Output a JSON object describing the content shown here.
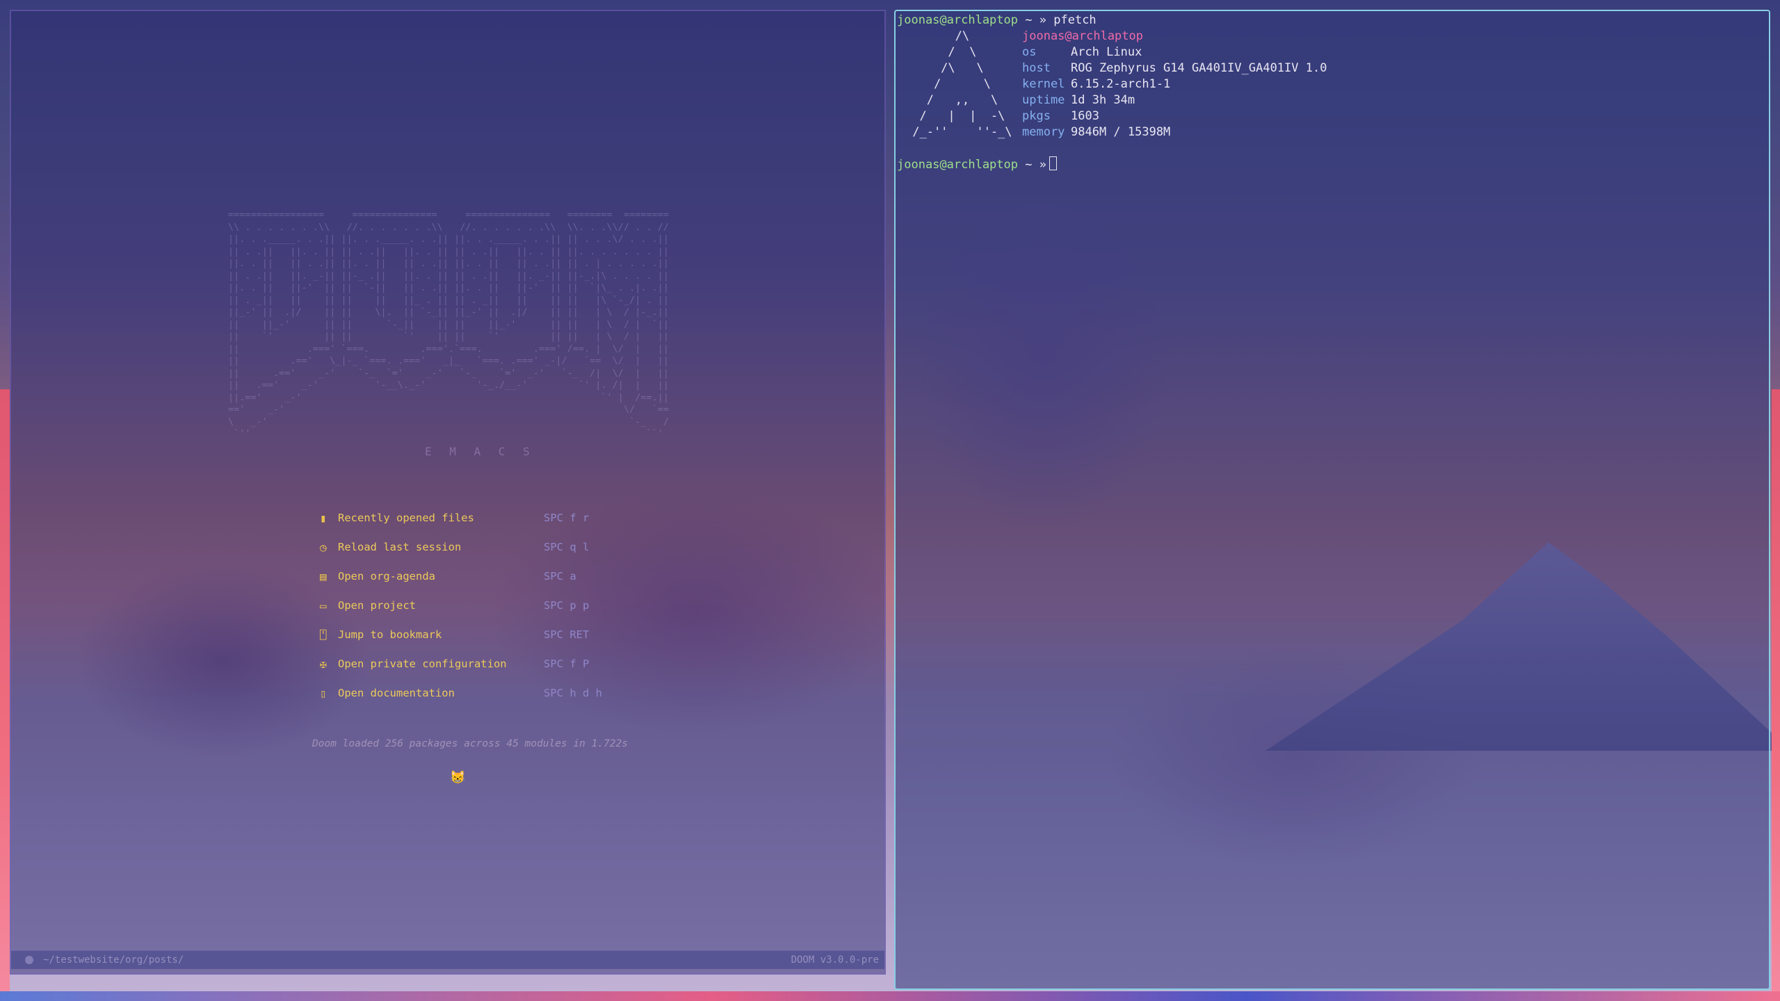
{
  "emacs": {
    "banner_ascii": "=================     ===============     ===============   ========  ========\n\\\\ . . . . . . .\\\\   //. . . . . . .\\\\   //. . . . . . .\\\\  \\\\. . .\\\\// . . //\n||. . ._____. . .|| ||. . ._____. . .|| ||. . ._____. . .|| || . . .\\/ . . .||\n|| . .||   ||. . || || . .||   ||. . || || . .||   ||. . || ||. . . . . . . ||\n||. . ||   || . .|| ||. . ||   || . .|| ||. . ||   || . .|| || . | . . . . .||\n|| . .||   ||. _-|| ||-_ .||   ||. . || || . .||   ||. _-|| ||-_.|\\ . . . . ||\n||. . ||   ||-'  || ||  `-||   || . .|| ||. . ||   ||-'  || ||  `|\\_ . .|. .||\n|| . _||   ||    || ||    ||   ||_ . || || . _||   ||    || ||   |\\ `-_/| . ||\n||_-' ||  .|/    || ||    \\|.  || `-_|| ||_-' ||  .|/    || ||   | \\  / |-_.||\n||    ||_-'      || ||      `-_||    || ||    ||_-'      || ||   | \\  / |  `||\n||    `'         || ||         `'    || ||    `'         || ||   | \\  / |   ||\n||            .===' `===.         .==='.`===.         .===' /==. |  \\/  |   ||\n||         .=='   \\_|-_ `===. .==='   _|_   `===. .===' _-|/   `==  \\/  |   ||\n||      .=='    _-'    `-_  `='    _-'   `-_    `='  _-'   `-_  /|  \\/  |   ||\n||   .=='    _-'          '-__\\._-'         '-_./__-'         `' |. /|  |   ||\n||.=='    _-'                                                     `' |  /==.||\n=='    _-'                                                            \\/   `==\n\\   _-'                                                                `-_   /\n `''                                                                      ``'",
    "banner_sub": "E M A C S",
    "menu": [
      {
        "icon": "file-icon",
        "glyph": "▮",
        "label": "Recently opened files",
        "key": "SPC f r"
      },
      {
        "icon": "history-icon",
        "glyph": "◷",
        "label": "Reload last session",
        "key": "SPC q l"
      },
      {
        "icon": "calendar-icon",
        "glyph": "▤",
        "label": "Open org-agenda",
        "key": "SPC a"
      },
      {
        "icon": "briefcase-icon",
        "glyph": "▭",
        "label": "Open project",
        "key": "SPC p p"
      },
      {
        "icon": "bookmark-icon",
        "glyph": "⍞",
        "label": "Jump to bookmark",
        "key": "SPC RET"
      },
      {
        "icon": "tools-icon",
        "glyph": "✠",
        "label": "Open private configuration",
        "key": "SPC f P"
      },
      {
        "icon": "book-icon",
        "glyph": "▯",
        "label": "Open documentation",
        "key": "SPC h d h"
      }
    ],
    "benchmark": "Doom loaded 256 packages across 45 modules in 1.722s",
    "cat_glyph": "😸",
    "modeline_path": "~/testwebsite/org/posts/",
    "modeline_version": "DOOM v3.0.0-pre"
  },
  "terminal": {
    "prompt_user": "joonas@archlaptop",
    "prompt_tilde": "~",
    "prompt_arrow": "»",
    "command": "pfetch",
    "logo": "       /\\\n      /  \\\n     /\\   \\\n    /      \\\n   /   ,,   \\\n  /   |  |  -\\\n /_-''    ''-_\\",
    "header": "joonas@archlaptop",
    "info": [
      {
        "key": "os",
        "value": "Arch Linux"
      },
      {
        "key": "host",
        "value": "ROG Zephyrus G14 GA401IV_GA401IV 1.0"
      },
      {
        "key": "kernel",
        "value": "6.15.2-arch1-1"
      },
      {
        "key": "uptime",
        "value": "1d 3h 34m"
      },
      {
        "key": "pkgs",
        "value": "1603"
      },
      {
        "key": "memory",
        "value": "9846M / 15398M"
      }
    ]
  },
  "colors": {
    "prompt_green": "#9fe08a",
    "key_blue": "#86b1f0",
    "header_pink": "#f06ba8",
    "menu_yellow": "#ecca5a",
    "terminal_border": "#88cfe3"
  }
}
